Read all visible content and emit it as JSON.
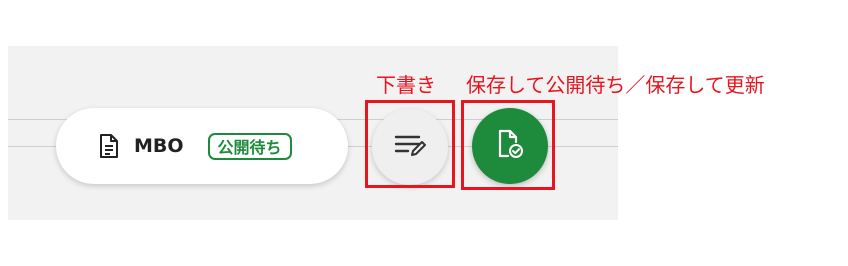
{
  "record": {
    "title": "MBO",
    "status_badge": "公開待ち",
    "status_color": "#1e8a3b"
  },
  "buttons": {
    "draft_icon": "edit-note-icon",
    "save_icon": "file-check-icon"
  },
  "annotations": {
    "draft_label": "下書き",
    "save_label": "保存して公開待ち／保存して更新",
    "highlight_color": "#e8141e"
  }
}
